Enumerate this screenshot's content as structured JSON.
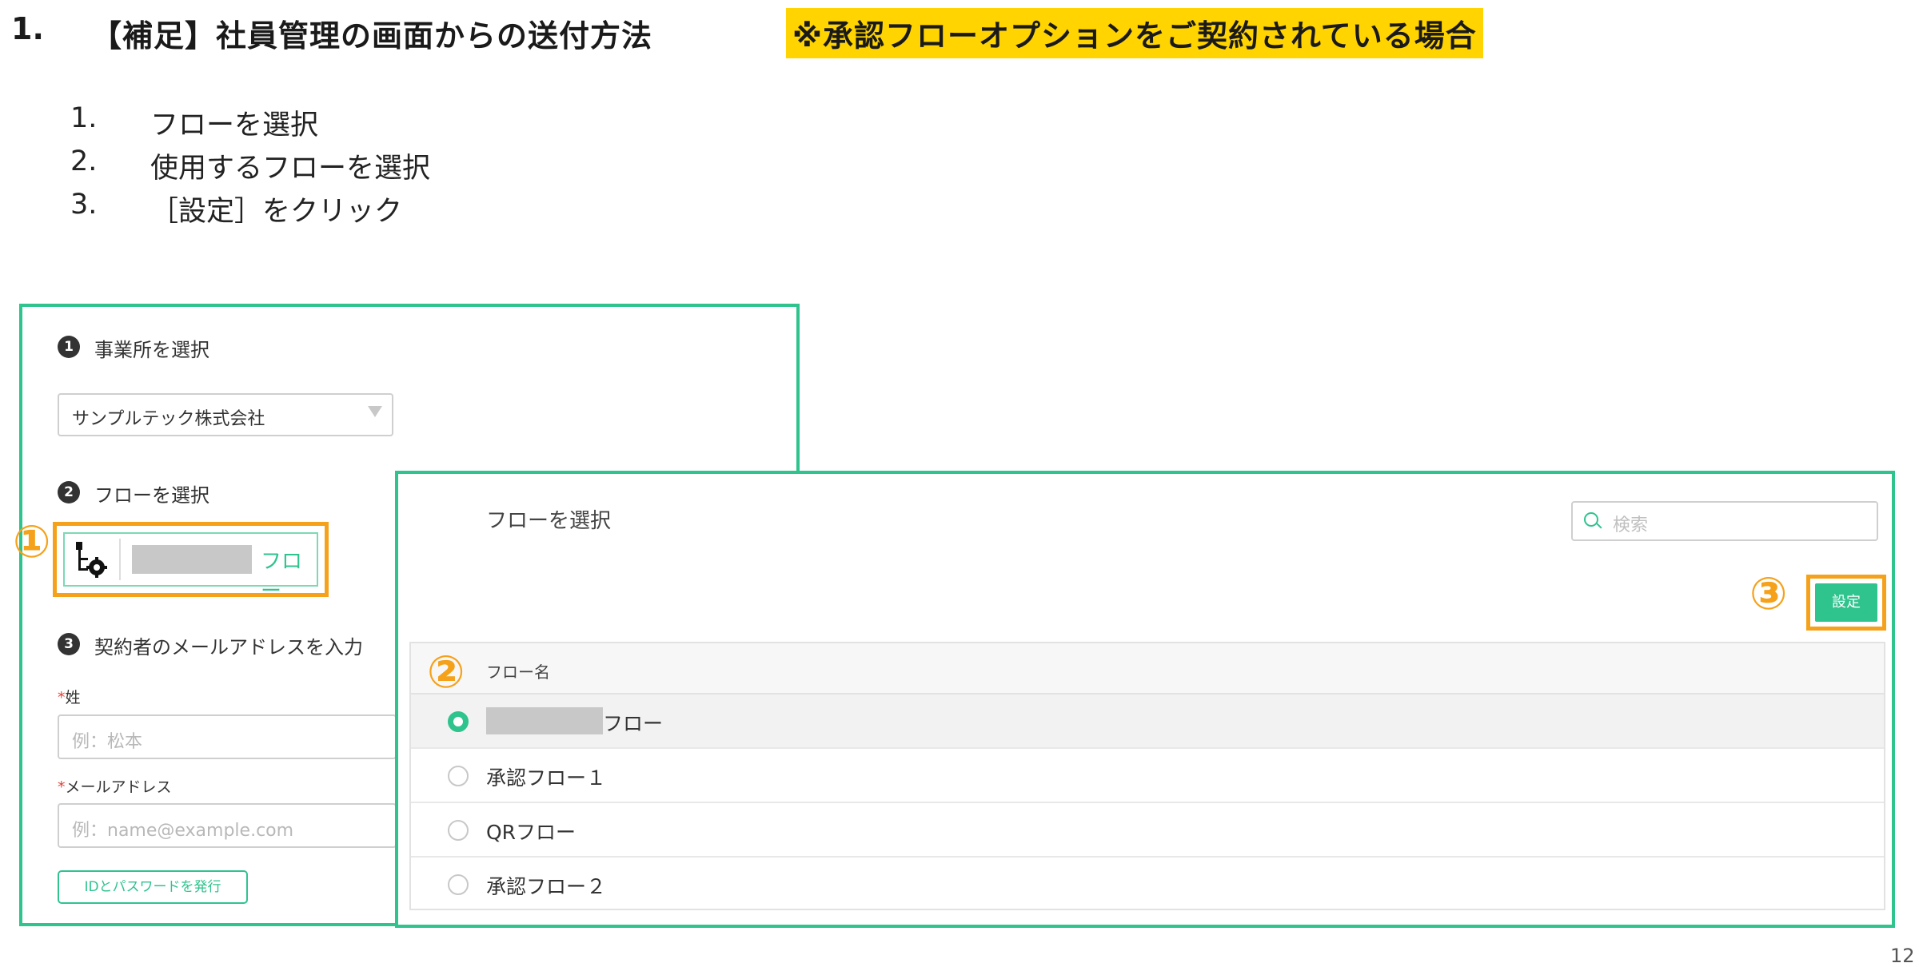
{
  "title": {
    "number": "1.",
    "text": "【補足】社員管理の画面からの送付方法",
    "note": "※承認フローオプションをご契約されている場合"
  },
  "steps": [
    {
      "num": "1.",
      "text": "フローを選択"
    },
    {
      "num": "2.",
      "text": "使用するフローを選択"
    },
    {
      "num": "3.",
      "text": "［設定］をクリック"
    }
  ],
  "callouts": {
    "one": "①",
    "two": "②",
    "three": "③"
  },
  "form": {
    "section1": {
      "num": "1",
      "label": "事業所を選択"
    },
    "office_select": {
      "value": "サンプルテック株式会社"
    },
    "section2": {
      "num": "2",
      "label": "フローを選択"
    },
    "flow_chip_label": "フロー",
    "section3": {
      "num": "3",
      "label": "契約者のメールアドレスを入力"
    },
    "last_name": {
      "required": "*",
      "label": "姓",
      "placeholder": "例：松本"
    },
    "email": {
      "required": "*",
      "label": "メールアドレス",
      "placeholder": "例：name@example.com"
    },
    "issue_button": "IDとパスワードを発行"
  },
  "flow_dialog": {
    "title": "フローを選択",
    "search_placeholder": "検索",
    "set_button": "設定",
    "column_header": "フロー名",
    "rows": [
      {
        "label": "フロー",
        "selected": true
      },
      {
        "label": "承認フロー１",
        "selected": false
      },
      {
        "label": "QRフロー",
        "selected": false
      },
      {
        "label": "承認フロー２",
        "selected": false
      }
    ]
  },
  "page_number": "12",
  "colors": {
    "accent": "#2fc38e",
    "highlight": "#ffd400",
    "callout": "#f5a11a"
  }
}
